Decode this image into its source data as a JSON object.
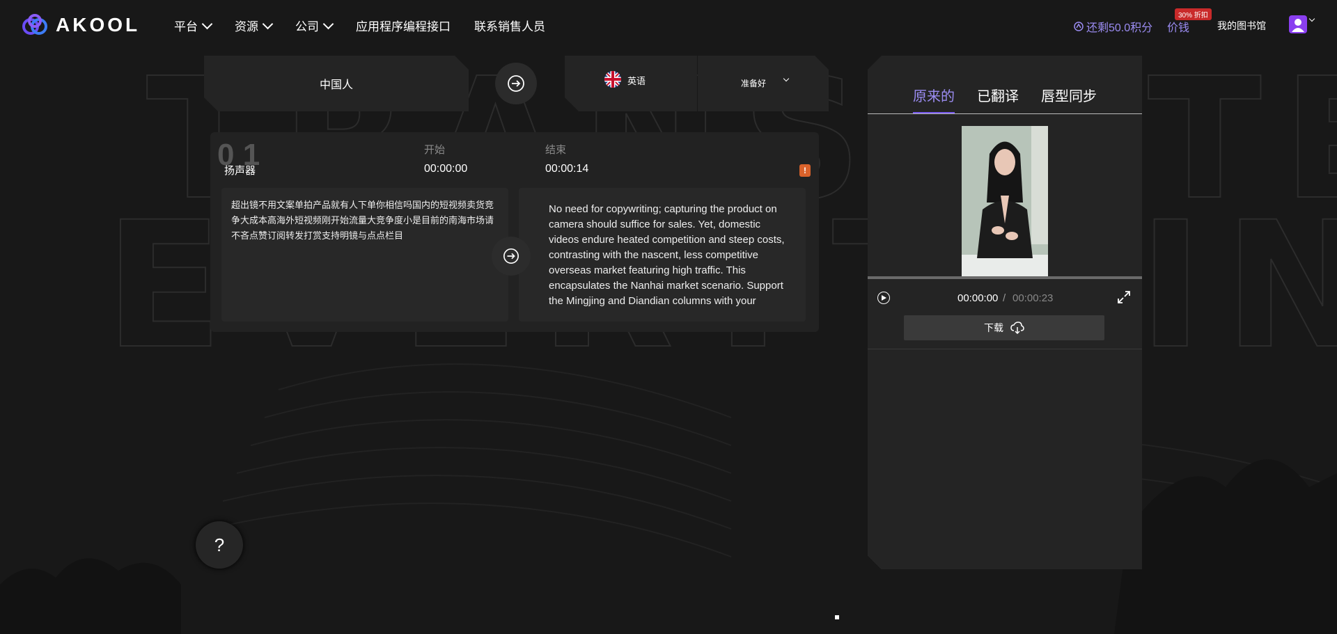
{
  "header": {
    "brand": "AKOOL",
    "nav": [
      {
        "label": "平台",
        "has_menu": true
      },
      {
        "label": "资源",
        "has_menu": true
      },
      {
        "label": "公司",
        "has_menu": true
      },
      {
        "label": "应用程序编程接口",
        "has_menu": false
      },
      {
        "label": "联系销售人员",
        "has_menu": false
      }
    ],
    "credits": "还剩50.0积分",
    "price": "价钱",
    "discount_badge": "30% 折扣",
    "library": "我的图书馆"
  },
  "languages": {
    "source": "中国人",
    "target": "英语",
    "status": "准备好"
  },
  "segment": {
    "number": "0 1",
    "speaker": "扬声器",
    "start_label": "开始",
    "start_value": "00:00:00",
    "end_label": "结束",
    "end_value": "00:00:14",
    "warning": "!",
    "source_text": "超出镜不用文案单拍产品就有人下单你相信吗国内的短视频卖货竞争大成本高海外短视频刚开始流量大竞争度小是目前的南海市场请不吝点赞订阅转发打赏支持明镜与点点栏目",
    "translated_text": "No need for copywriting; capturing the product on camera should suffice for sales. Yet, domestic videos endure heated competition and steep costs, contrasting with the nascent, less competitive overseas market featuring high traffic. This encapsulates the Nanhai market scenario. Support the Mingjing and Diandian columns with your"
  },
  "panel": {
    "tabs": [
      "原来的",
      "已翻译",
      "唇型同步"
    ],
    "active_tab": 0,
    "current_time": "00:00:00",
    "separator": "/",
    "total_time": "00:00:23",
    "download_label": "下载"
  },
  "help": {
    "label": "?"
  },
  "colors": {
    "accent": "#9b8cf2",
    "background": "#181818",
    "card": "#222222",
    "warning": "#d9622b"
  }
}
